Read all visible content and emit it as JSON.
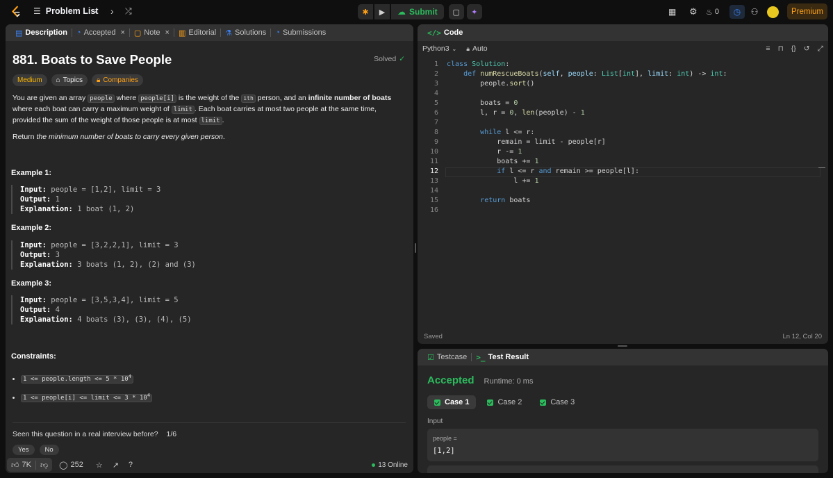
{
  "topbar": {
    "problem_list": "Problem List",
    "submit": "Submit",
    "streak": "0",
    "premium": "Premium"
  },
  "desc_tabs": [
    "Description",
    "Accepted",
    "Note",
    "Editorial",
    "Solutions",
    "Submissions"
  ],
  "problem": {
    "title": "881. Boats to Save People",
    "status": "Solved",
    "difficulty": "Medium",
    "topics": "Topics",
    "companies": "Companies",
    "p1_a": "You are given an array ",
    "p1_code1": "people",
    "p1_b": " where ",
    "p1_code2": "people[i]",
    "p1_c": " is the weight of the ",
    "p1_sup": "ith",
    "p1_d": " person, and an ",
    "p1_bold": "infinite number of boats",
    "p1_e": " where each boat can carry a maximum weight of ",
    "p1_code3": "limit",
    "p1_f": ". Each boat carries at most two people at the same time, provided the sum of the weight of those people is at most ",
    "p1_code4": "limit",
    "p1_g": ".",
    "p2_a": "Return ",
    "p2_i": "the minimum number of boats to carry every given person",
    "p2_b": "."
  },
  "examples": [
    {
      "title": "Example 1:",
      "input": "people = [1,2], limit = 3",
      "output": "1",
      "explanation": "1 boat (1, 2)"
    },
    {
      "title": "Example 2:",
      "input": "people = [3,2,2,1], limit = 3",
      "output": "3",
      "explanation": "3 boats (1, 2), (2) and (3)"
    },
    {
      "title": "Example 3:",
      "input": "people = [3,5,3,4], limit = 5",
      "output": "4",
      "explanation": "4 boats (3), (3), (4), (5)"
    }
  ],
  "labels": {
    "input": "Input:",
    "output": "Output:",
    "explanation": "Explanation:"
  },
  "constraints": {
    "title": "Constraints:",
    "c1": "1 <= people.length <= 5 * 10",
    "c1_sup": "4",
    "c2": "1 <= people[i] <= limit <= 3 * 10",
    "c2_sup": "4"
  },
  "interview": {
    "question": "Seen this question in a real interview before?",
    "count": "1/6",
    "yes": "Yes",
    "no": "No"
  },
  "footer": {
    "likes": "7K",
    "comments": "252",
    "online": "13 Online"
  },
  "code_panel": {
    "title": "Code",
    "language": "Python3",
    "auto": "Auto",
    "saved": "Saved",
    "cursor": "Ln 12, Col 20"
  },
  "code_lines": [
    "1",
    "2",
    "3",
    "4",
    "5",
    "6",
    "7",
    "8",
    "9",
    "10",
    "11",
    "12",
    "13",
    "14",
    "15",
    "16"
  ],
  "result_panel": {
    "testcase_tab": "Testcase",
    "result_tab": "Test Result",
    "verdict": "Accepted",
    "runtime": "Runtime: 0 ms",
    "cases": [
      "Case 1",
      "Case 2",
      "Case 3"
    ],
    "input_label": "Input",
    "var_name": "people =",
    "var_value": "[1,2]"
  },
  "colors": {
    "accent_green": "#2cbb5d",
    "premium": "#ffa116",
    "medium": "#ffb800"
  }
}
